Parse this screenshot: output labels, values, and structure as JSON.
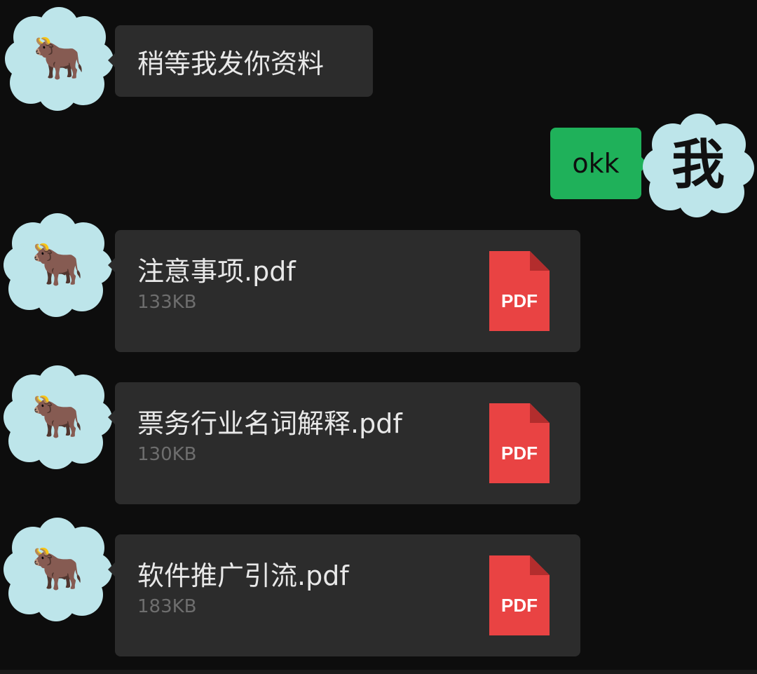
{
  "colors": {
    "background": "#0d0d0d",
    "bubble": "#2c2c2c",
    "my_bubble": "#1fb15a",
    "avatar_cloud": "#bde5ea",
    "pdf_red": "#e94343"
  },
  "messages": [
    {
      "sender": "other",
      "avatar_icon": "cow-icon",
      "avatar": "🐂",
      "type": "text",
      "text": "稍等我发你资料"
    },
    {
      "sender": "me",
      "avatar_icon": "me-character-icon",
      "avatar": "我",
      "type": "text",
      "text": "okk"
    },
    {
      "sender": "other",
      "avatar_icon": "cow-icon",
      "avatar": "🐂",
      "type": "file",
      "file_name": "注意事项.pdf",
      "file_size": "133KB",
      "file_icon": "pdf-file-icon",
      "file_icon_label": "PDF"
    },
    {
      "sender": "other",
      "avatar_icon": "cow-icon",
      "avatar": "🐂",
      "type": "file",
      "file_name": "票务行业名词解释.pdf",
      "file_size": "130KB",
      "file_icon": "pdf-file-icon",
      "file_icon_label": "PDF"
    },
    {
      "sender": "other",
      "avatar_icon": "cow-icon",
      "avatar": "🐂",
      "type": "file",
      "file_name": "软件推广引流.pdf",
      "file_size": "183KB",
      "file_icon": "pdf-file-icon",
      "file_icon_label": "PDF"
    }
  ]
}
